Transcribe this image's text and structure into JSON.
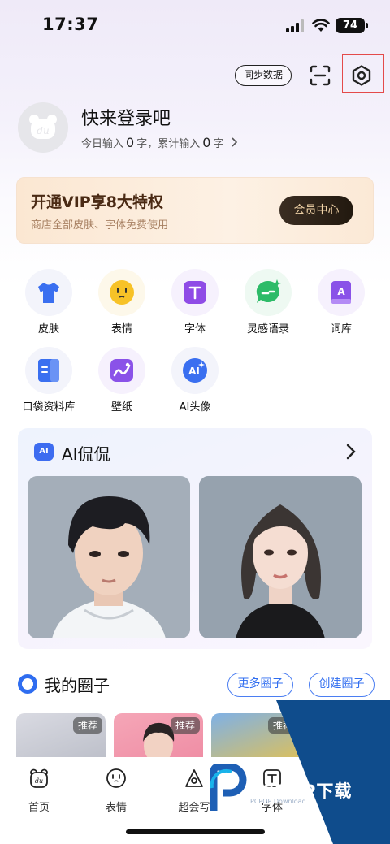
{
  "status": {
    "time": "17:37",
    "battery": "74"
  },
  "header": {
    "sync_label": "同步数据",
    "scan_icon": "scan-icon",
    "settings_icon": "gear-icon"
  },
  "profile": {
    "login_text": "快来登录吧",
    "stats_prefix": "今日输入",
    "today_count": "0",
    "unit1": "字，累计输入",
    "total_count": "0",
    "unit2": "字"
  },
  "vip": {
    "title": "开通VIP享8大特权",
    "subtitle": "商店全部皮肤、字体免费使用",
    "button": "会员中心"
  },
  "grid": [
    {
      "label": "皮肤",
      "icon": "tshirt-icon",
      "color": "#3a6ff0"
    },
    {
      "label": "表情",
      "icon": "emoji-icon",
      "color": "#f7c227"
    },
    {
      "label": "字体",
      "icon": "font-icon",
      "color": "#8f4be6"
    },
    {
      "label": "灵感语录",
      "icon": "chat-sparkle-icon",
      "color": "#2dbb68"
    },
    {
      "label": "词库",
      "icon": "dictionary-icon",
      "color": "#8a52e8"
    },
    {
      "label": "口袋资料库",
      "icon": "pocket-library-icon",
      "color": "#3a6ff0"
    },
    {
      "label": "壁纸",
      "icon": "wallpaper-icon",
      "color": "#8a52e8"
    },
    {
      "label": "AI头像",
      "icon": "ai-avatar-icon",
      "color": "#3a6ff0"
    }
  ],
  "ai_card": {
    "badge": "AI",
    "title": "AI侃侃"
  },
  "circles": {
    "title": "我的圈子",
    "more_button": "更多圈子",
    "create_button": "创建圈子",
    "tags": [
      "推荐",
      "推荐",
      "推荐",
      "推荐"
    ]
  },
  "tabs": [
    {
      "label": "首页",
      "icon": "home-bear-icon"
    },
    {
      "label": "表情",
      "icon": "emoji-face-icon"
    },
    {
      "label": "超会写",
      "icon": "ai-write-icon"
    },
    {
      "label": "字体",
      "icon": "font-tab-icon"
    }
  ],
  "watermark": {
    "text": "PCPOP下载",
    "sub": "PCPOP Download"
  },
  "colors": {
    "accent": "#2f6df0",
    "vip_dark": "#2a1f15",
    "highlight": "#e44a4a"
  }
}
